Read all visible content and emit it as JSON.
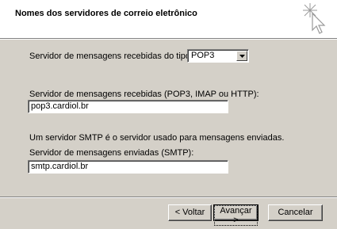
{
  "header": {
    "title": "Nomes dos servidores de correio eletrônico",
    "icon": "wizard-sparkle-cursor-icon"
  },
  "incoming_type": {
    "label": "Servidor de mensagens recebidas do tipo",
    "selected": "POP3"
  },
  "incoming_server": {
    "label": "Servidor de mensagens recebidas (POP3, IMAP ou HTTP):",
    "value": "pop3.cardiol.br"
  },
  "smtp_info": "Um servidor SMTP é o servidor usado para mensagens enviadas.",
  "outgoing_server": {
    "label": "Servidor de mensagens enviadas (SMTP):",
    "value": "smtp.cardiol.br"
  },
  "buttons": {
    "back": "< Voltar",
    "next": "Avançar >",
    "cancel": "Cancelar"
  }
}
